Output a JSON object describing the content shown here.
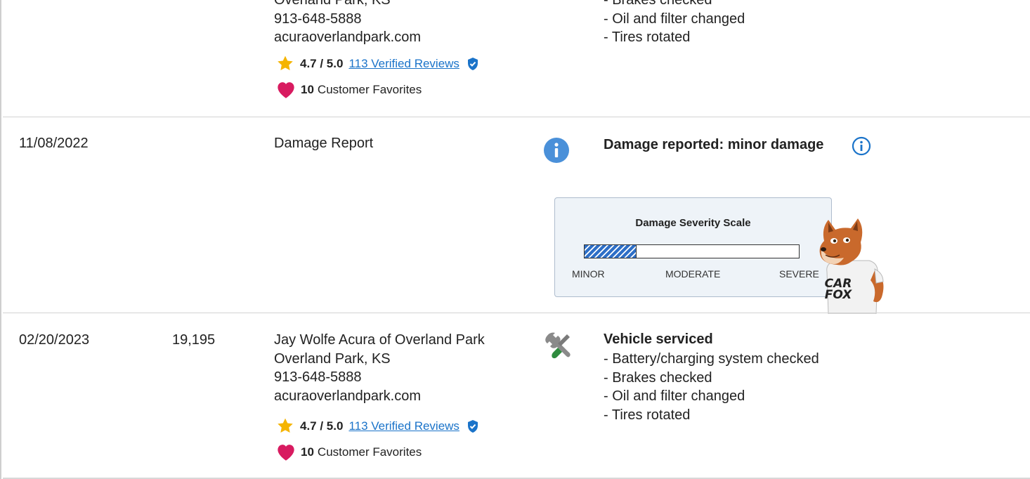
{
  "colors": {
    "link": "#1a73c9",
    "info_icon": "#4a90d9",
    "star": "#f5b400",
    "heart": "#d81b60",
    "damage_fill": "#2e6fc7"
  },
  "rows": [
    {
      "date": "",
      "mileage": "",
      "dealer": {
        "lines": [
          "Overland Park, KS",
          "913-648-5888",
          "acuraoverlandpark.com"
        ],
        "rating_score": "4.7 / 5.0",
        "reviews_link": "113 Verified Reviews",
        "favorites_count": "10",
        "favorites_label": "Customer Favorites"
      },
      "detail": {
        "items": [
          "- Brakes checked",
          "- Oil and filter changed",
          "- Tires rotated"
        ]
      }
    },
    {
      "date": "11/08/2022",
      "source": "Damage Report",
      "icon": "info-icon",
      "detail": {
        "headline": "Damage reported: minor damage",
        "scale": {
          "title": "Damage Severity Scale",
          "level": 0.24,
          "labels": [
            "MINOR",
            "MODERATE",
            "SEVERE"
          ]
        },
        "mascot_text": [
          "CAR",
          "FOX"
        ]
      }
    },
    {
      "date": "02/20/2023",
      "mileage": "19,195",
      "icon": "wrench-screwdriver-icon",
      "dealer": {
        "lines": [
          "Jay Wolfe Acura of Overland Park",
          "Overland Park, KS",
          "913-648-5888",
          "acuraoverlandpark.com"
        ],
        "rating_score": "4.7 / 5.0",
        "reviews_link": "113 Verified Reviews",
        "favorites_count": "10",
        "favorites_label": "Customer Favorites"
      },
      "detail": {
        "headline": "Vehicle serviced",
        "items": [
          "- Battery/charging system checked",
          "- Brakes checked",
          "- Oil and filter changed",
          "- Tires rotated"
        ]
      }
    }
  ]
}
